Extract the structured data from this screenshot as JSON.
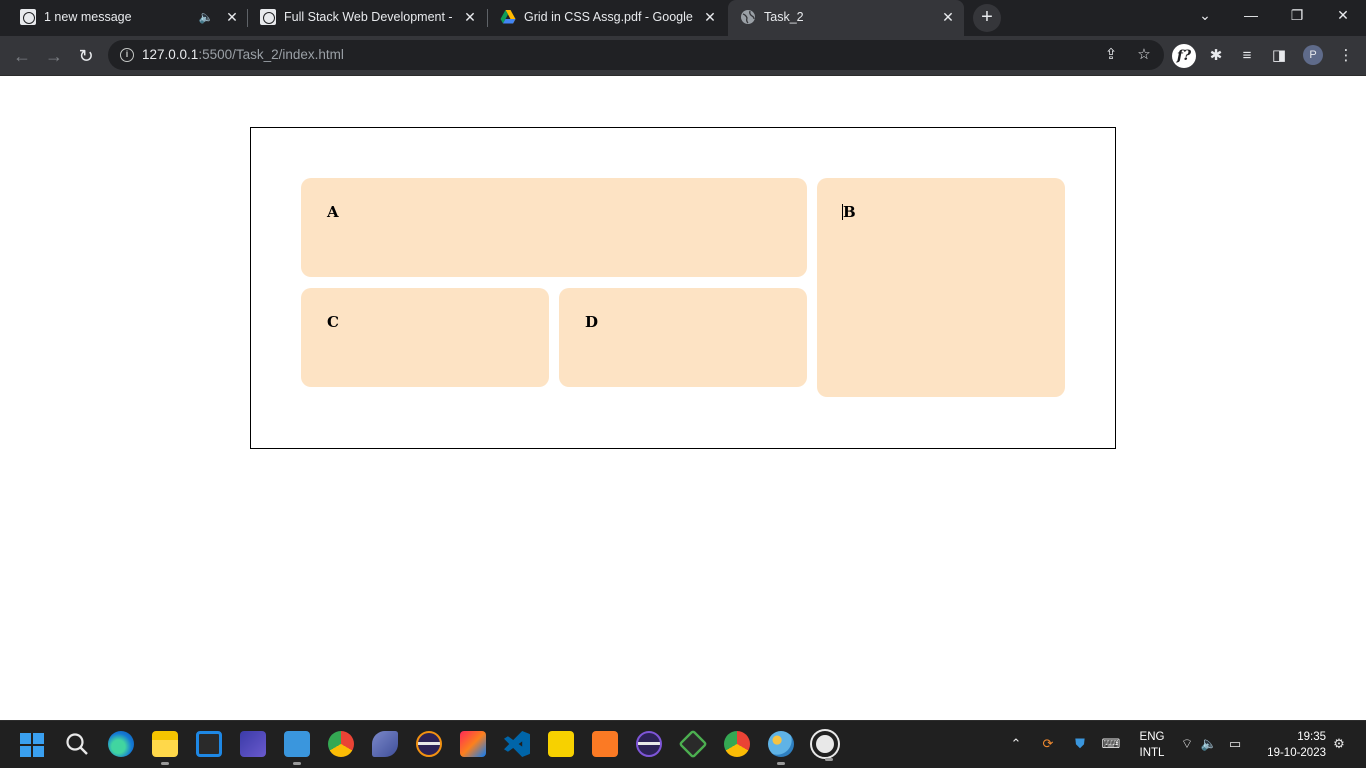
{
  "browser": {
    "tabs": [
      {
        "title": "1 new message",
        "favicon": "wordpress-icon",
        "muted_icon": "speaker-icon"
      },
      {
        "title": "Full Stack Web Development - C",
        "favicon": "wordpress-icon"
      },
      {
        "title": "Grid in CSS Assg.pdf - Google D",
        "favicon": "google-drive-icon"
      },
      {
        "title": "Task_2",
        "favicon": "globe-icon",
        "active": true
      }
    ],
    "new_tab_label": "+",
    "window_controls": {
      "list": "⌄",
      "minimize": "—",
      "restore": "❐",
      "close": "✕"
    },
    "address": {
      "host": "127.0.0.1",
      "path": ":5500/Task_2/index.html"
    },
    "profile_initial": "P",
    "extension_label": "f?"
  },
  "page": {
    "grid_items": {
      "a": "A",
      "b": "B",
      "c": "C",
      "d": "D"
    },
    "item_color": "#fde3c4",
    "border_color": "#000000"
  },
  "taskbar": {
    "apps": [
      "start-icon",
      "search-icon",
      "edge-icon",
      "file-explorer-icon",
      "microsoft-store-icon",
      "app-icon",
      "notepad-icon",
      "chrome-icon",
      "dolphin-icon",
      "eclipse-icon",
      "intellij-icon",
      "vscode-icon",
      "sticky-notes-icon",
      "xampp-icon",
      "eclipse-icon",
      "git-icon",
      "chrome-profile-icon",
      "paint-icon",
      "obs-icon"
    ],
    "language": "ENG",
    "layout": "INTL",
    "time": "19:35",
    "date": "19-10-2023"
  }
}
